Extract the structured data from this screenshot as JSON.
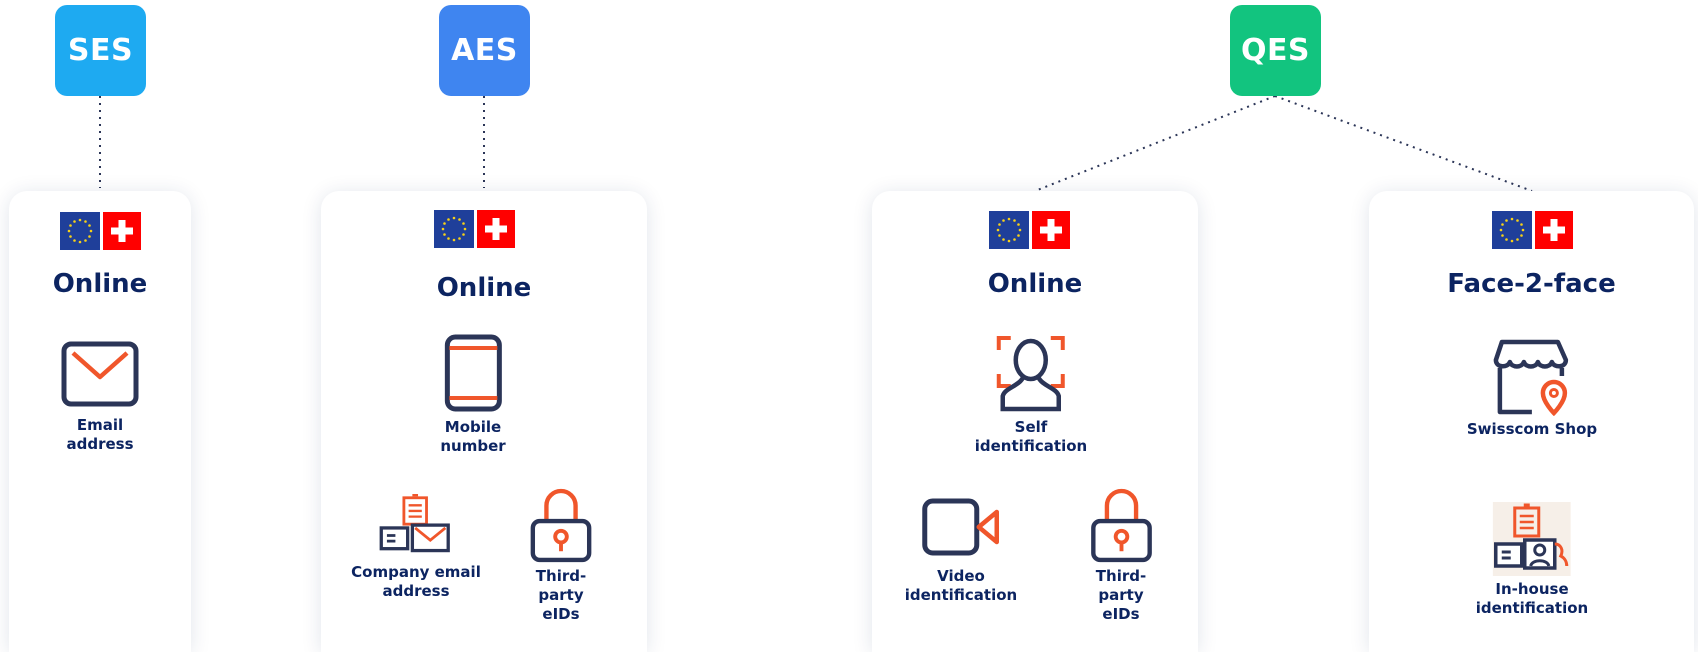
{
  "colors": {
    "ses": "#1eaaf1",
    "aes": "#3f85f0",
    "qes": "#12c47f",
    "navy": "#0c2461",
    "icon_dark": "#2b3557",
    "icon_accent": "#f0562b",
    "eu_blue": "#1f3f9a",
    "eu_star": "#f7d117",
    "swiss_red": "#ff0000"
  },
  "levels": [
    {
      "label": "SES"
    },
    {
      "label": "AES"
    },
    {
      "label": "QES"
    }
  ],
  "cards": [
    {
      "title": "Online",
      "items": [
        {
          "icon": "envelope-icon",
          "label": "Email\naddress"
        }
      ]
    },
    {
      "title": "Online",
      "items": [
        {
          "icon": "mobile-phone-icon",
          "label": "Mobile\nnumber"
        },
        {
          "icon": "company-email-icon",
          "label": "Company email\naddress"
        },
        {
          "icon": "padlock-icon",
          "label": "Third-party\neIDs"
        }
      ]
    },
    {
      "title": "Online",
      "items": [
        {
          "icon": "face-scan-icon",
          "label": "Self\nidentification"
        },
        {
          "icon": "video-camera-icon",
          "label": "Video\nidentification"
        },
        {
          "icon": "padlock-icon",
          "label": "Third-party\neIDs"
        }
      ]
    },
    {
      "title": "Face-2-face",
      "items": [
        {
          "icon": "shop-location-icon",
          "label": "Swisscom Shop"
        },
        {
          "icon": "in-house-id-icon",
          "label": "In-house\nidentification"
        }
      ]
    }
  ]
}
